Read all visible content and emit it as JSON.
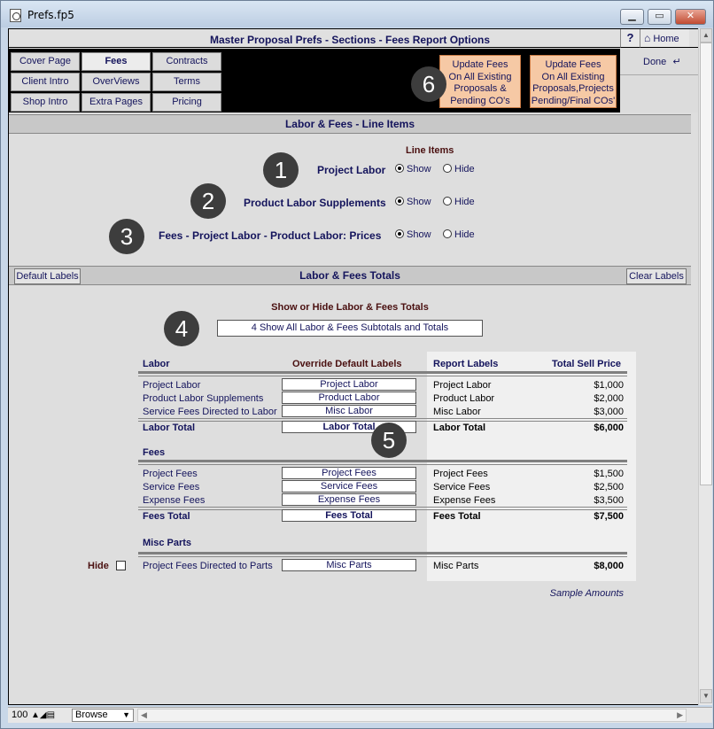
{
  "window": {
    "title": "Prefs.fp5"
  },
  "header": {
    "title": "Master Proposal Prefs - Sections - Fees Report Options",
    "help": "?",
    "home": "Home",
    "done": "Done"
  },
  "nav": [
    {
      "label": "Cover Page"
    },
    {
      "label": "Fees"
    },
    {
      "label": "Contracts"
    },
    {
      "label": "Client Intro"
    },
    {
      "label": "OverViews"
    },
    {
      "label": "Terms"
    },
    {
      "label": "Shop Intro"
    },
    {
      "label": "Extra Pages"
    },
    {
      "label": "Pricing"
    }
  ],
  "update_buttons": {
    "a": [
      "Update Fees",
      "On All Existing",
      "Proposals &",
      "Pending CO's"
    ],
    "b": [
      "Update Fees",
      "On All Existing",
      "Proposals,Projects",
      "Pending/Final COs'"
    ]
  },
  "badges": [
    "1",
    "2",
    "3",
    "4",
    "5",
    "6"
  ],
  "line_items": {
    "bar": "Labor & Fees -  Line Items",
    "heading": "Line Items",
    "rows": [
      {
        "label": "Project Labor",
        "show": "Show",
        "hide": "Hide",
        "selected": "Show"
      },
      {
        "label": "Product Labor Supplements",
        "show": "Show",
        "hide": "Hide",
        "selected": "Show"
      },
      {
        "label": "Fees - Project Labor - Product Labor:  Prices",
        "show": "Show",
        "hide": "Hide",
        "selected": "Show"
      }
    ]
  },
  "totals": {
    "bar": "Labor & Fees Totals",
    "default_labels": "Default Labels",
    "clear_labels": "Clear Labels",
    "heading": "Show or Hide Labor & Fees Totals",
    "dropdown_value": "4 Show All Labor & Fees Subtotals and Totals"
  },
  "table": {
    "col_labor": "Labor",
    "col_override": "Override Default Labels",
    "col_report": "Report Labels",
    "col_total": "Total Sell Price",
    "labor_rows": [
      {
        "name": "Project Labor",
        "override": "Project Labor",
        "report": "Project Labor",
        "amount": "$1,000"
      },
      {
        "name": "Product Labor Supplements",
        "override": "Product Labor",
        "report": "Product Labor",
        "amount": "$2,000"
      },
      {
        "name": "Service Fees Directed to Labor",
        "override": "Misc Labor",
        "report": "Misc Labor",
        "amount": "$3,000"
      }
    ],
    "labor_total": {
      "name": "Labor Total",
      "override": "Labor Total",
      "report": "Labor Total",
      "amount": "$6,000"
    },
    "fees_heading": "Fees",
    "fees_rows": [
      {
        "name": "Project Fees",
        "override": "Project Fees",
        "report": "Project Fees",
        "amount": "$1,500"
      },
      {
        "name": "Service Fees",
        "override": "Service Fees",
        "report": "Service Fees",
        "amount": "$2,500"
      },
      {
        "name": "Expense Fees",
        "override": "Expense Fees",
        "report": "Expense Fees",
        "amount": "$3,500"
      }
    ],
    "fees_total": {
      "name": "Fees Total",
      "override": "Fees Total",
      "report": "Fees Total",
      "amount": "$7,500"
    },
    "misc_heading": "Misc Parts",
    "misc_hide": "Hide",
    "misc_row": {
      "name": "Project Fees Directed to Parts",
      "override": "Misc Parts",
      "report": "Misc Parts",
      "amount": "$8,000"
    },
    "sample": "Sample Amounts"
  },
  "status": {
    "zoom": "100",
    "mode": "Browse"
  }
}
